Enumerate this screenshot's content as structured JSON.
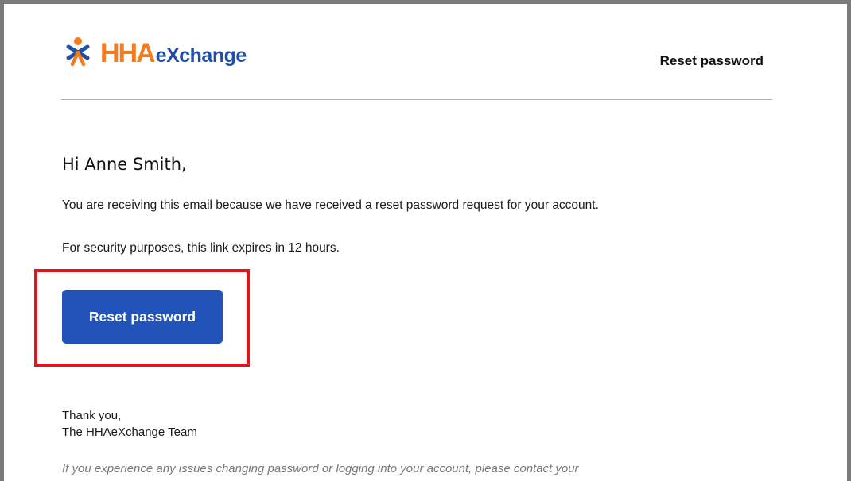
{
  "brand": {
    "logo_hha": "HHA",
    "logo_exchange": "eXchange",
    "orange": "#f47b20",
    "blue": "#1f4fa6",
    "icon": "caregiver-person-icon"
  },
  "header": {
    "title": "Reset password"
  },
  "email": {
    "greeting": "Hi Anne Smith,",
    "paragraph_1": "You are receiving this email because we have received a reset password request for your account.",
    "paragraph_2": "For security purposes, this link expires in 12 hours.",
    "button_label": "Reset password",
    "button_color": "#2253b8",
    "highlight_color": "#e3141c",
    "signoff_line_1": "Thank you,",
    "signoff_line_2": "The HHAeXchange Team",
    "footnote": "If you experience any issues changing password or logging into your account, please contact your"
  }
}
